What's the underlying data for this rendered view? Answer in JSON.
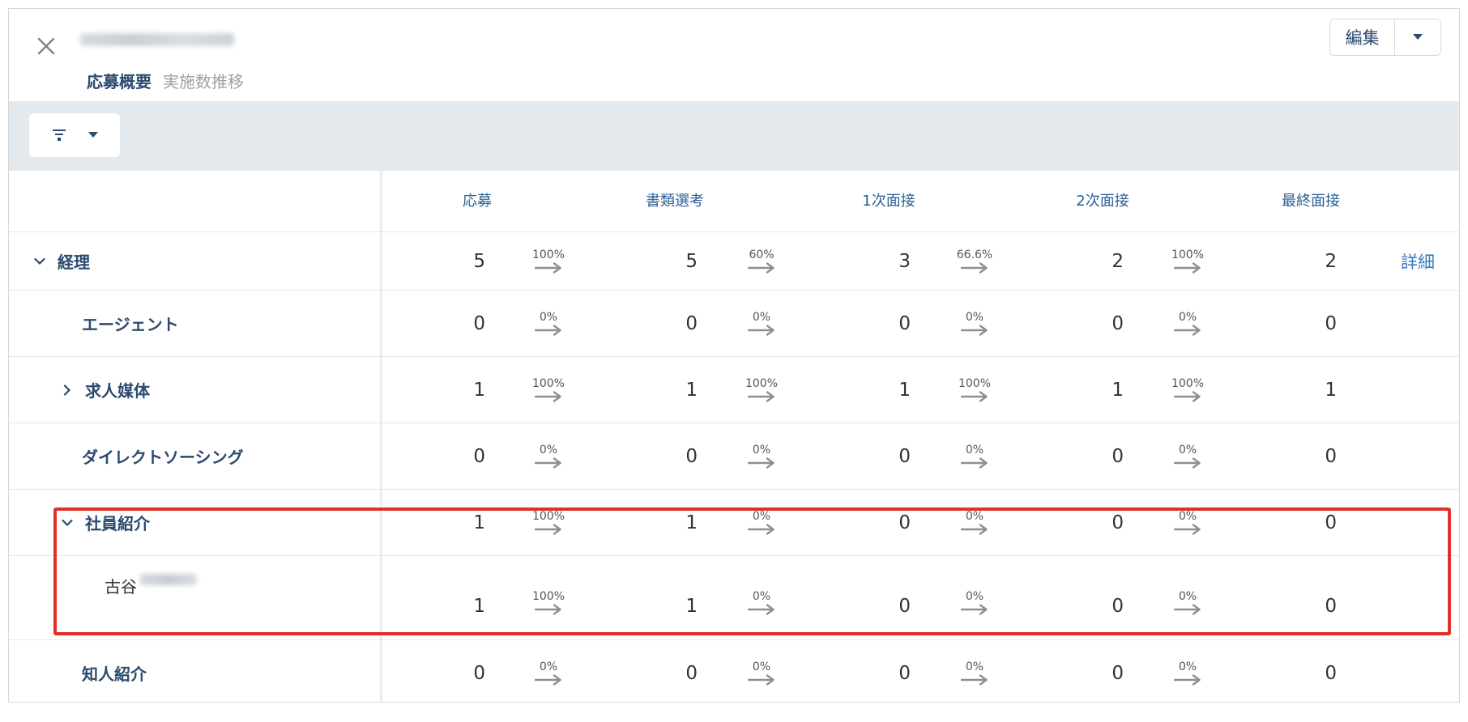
{
  "header": {
    "tabs": [
      {
        "label": "応募概要",
        "active": true
      },
      {
        "label": "実施数推移",
        "active": false
      }
    ],
    "edit_label": "編集"
  },
  "columns": [
    "応募",
    "書類選考",
    "1次面接",
    "2次面接",
    "最終面接"
  ],
  "detail_label": "詳細",
  "rows": [
    {
      "label": "経理",
      "expander": "down",
      "counts": [
        "5",
        "5",
        "3",
        "2",
        "2"
      ],
      "rates": [
        "100%",
        "60%",
        "66.6%",
        "100%"
      ],
      "detail": true
    },
    {
      "label": "エージェント",
      "expander": null,
      "counts": [
        "0",
        "0",
        "0",
        "0",
        "0"
      ],
      "rates": [
        "0%",
        "0%",
        "0%",
        "0%"
      ]
    },
    {
      "label": "求人媒体",
      "expander": "right",
      "counts": [
        "1",
        "1",
        "1",
        "1",
        "1"
      ],
      "rates": [
        "100%",
        "100%",
        "100%",
        "100%"
      ]
    },
    {
      "label": "ダイレクトソーシング",
      "expander": null,
      "counts": [
        "0",
        "0",
        "0",
        "0",
        "0"
      ],
      "rates": [
        "0%",
        "0%",
        "0%",
        "0%"
      ]
    },
    {
      "label": "社員紹介",
      "expander": "down",
      "counts": [
        "1",
        "1",
        "0",
        "0",
        "0"
      ],
      "rates": [
        "100%",
        "0%",
        "0%",
        "0%"
      ]
    },
    {
      "label": "古谷",
      "expander": null,
      "counts": [
        "1",
        "1",
        "0",
        "0",
        "0"
      ],
      "rates": [
        "100%",
        "0%",
        "0%",
        "0%"
      ]
    },
    {
      "label": "知人紹介",
      "expander": null,
      "counts": [
        "0",
        "0",
        "0",
        "0",
        "0"
      ],
      "rates": [
        "0%",
        "0%",
        "0%",
        "0%"
      ]
    }
  ],
  "colors": {
    "accent": "#2b4a6f",
    "link": "#3a7bc1",
    "highlight": "#e0302a",
    "filterbar": "#e4e9ee"
  }
}
